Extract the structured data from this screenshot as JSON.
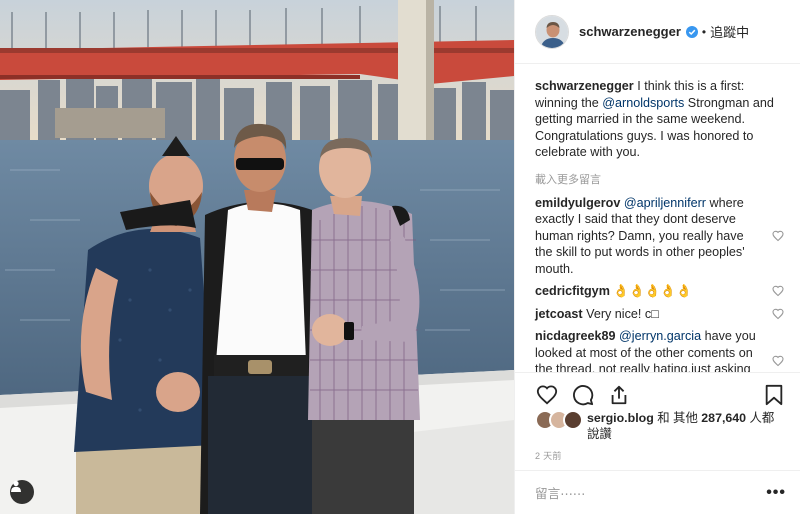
{
  "header": {
    "username": "schwarzenegger",
    "verified_icon": "verified-badge-icon",
    "separator": "•",
    "follow_state": "追蹤中"
  },
  "caption": {
    "username": "schwarzenegger",
    "text_before": " I think this is a first: winning the ",
    "mention": "@arnoldsports",
    "text_after": " Strongman and getting married in the same weekend. Congratulations guys. I was honored to celebrate with you."
  },
  "load_more": "載入更多留言",
  "comments": [
    {
      "username": "emildyulgerov",
      "mention": "@apriljenniferr",
      "text": " where exactly I said that they dont deserve human rights? Damn, you really have the skill to put words in other peoples' mouth.",
      "has_like": true
    },
    {
      "username": "cedricfitgym",
      "mention": "",
      "text": " 👌👌👌👌👌",
      "has_like": true
    },
    {
      "username": "jetcoast",
      "mention": "",
      "text": " Very nice! c□",
      "has_like": true
    },
    {
      "username": "nicdagreek89",
      "mention": "@jerryn.garcia",
      "text": " have you looked at most of the other coments on the thread. not really hating,just asking questions.",
      "has_like": true
    }
  ],
  "likes": {
    "liker": "sergio.blog",
    "connector": " 和 其他 ",
    "count": "287,640",
    "suffix": " 人都說讚"
  },
  "timestamp": "2 天前",
  "add_comment": {
    "placeholder": "留言⋯⋯",
    "more": "•••"
  },
  "colors": {
    "mention": "#003569",
    "verified": "#3897f0",
    "border": "#efefef",
    "muted": "#999999"
  }
}
